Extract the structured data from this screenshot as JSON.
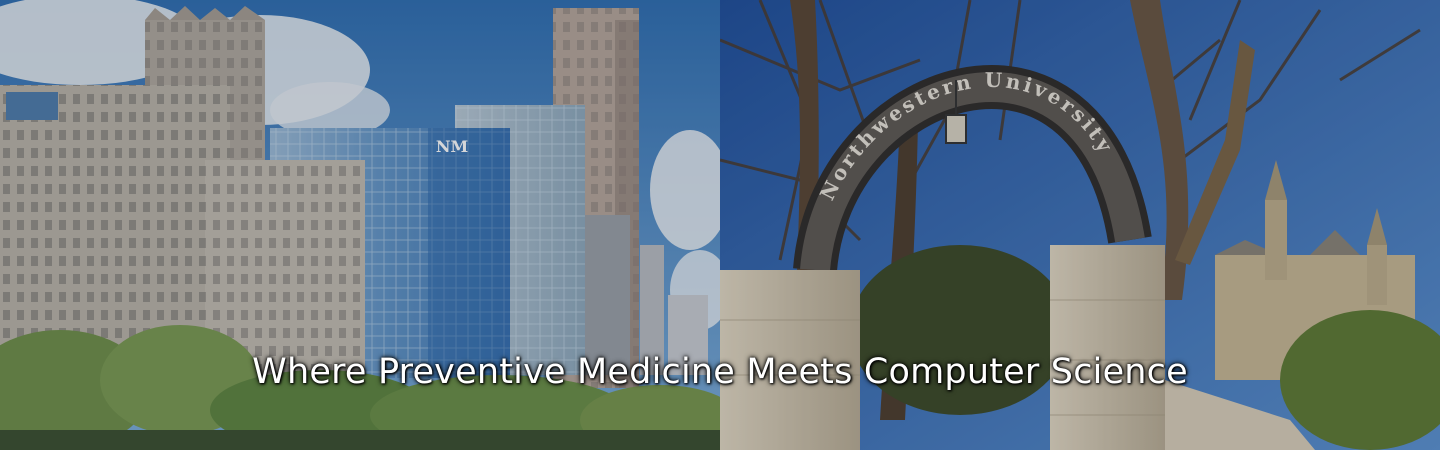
{
  "banner": {
    "headline": "Where Preventive Medicine Meets Computer Science",
    "building_logo": "NM",
    "arch_inscription": "Northwestern University",
    "colors": {
      "sky_left": "#3f7fc0",
      "sky_right": "#2d64b4",
      "stone": "#cfc4ad",
      "foliage": "#5e8a3a",
      "glass_tower": "#5a8ec4",
      "headline_text": "#ffffff"
    }
  }
}
